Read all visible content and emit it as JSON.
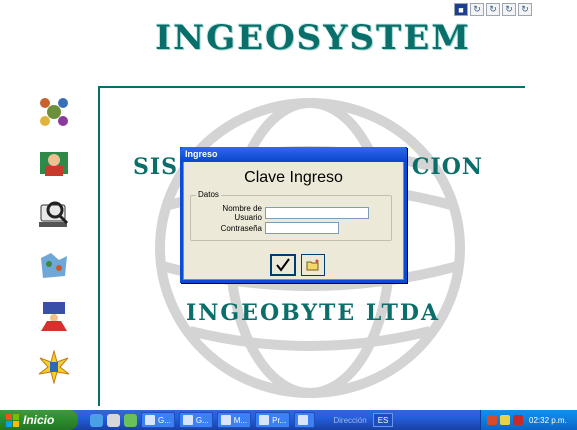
{
  "app": {
    "title": "INGEOSYSTEM",
    "subtitle_left": "SIS",
    "subtitle_right": "CION",
    "company": "INGEOBYTE LTDA"
  },
  "side_icons": [
    {
      "name": "team-icon"
    },
    {
      "name": "reading-person-icon"
    },
    {
      "name": "magnifier-computer-icon"
    },
    {
      "name": "map-icon"
    },
    {
      "name": "presenter-icon"
    },
    {
      "name": "starburst-icon"
    }
  ],
  "dialog": {
    "title": "Ingreso",
    "heading": "Clave Ingreso",
    "group_label": "Datos",
    "username_label": "Nombre de Usuario",
    "username_value": "",
    "password_label": "Contraseña",
    "password_value": ""
  },
  "taskbar": {
    "start_label": "Inicio",
    "tasks": [
      {
        "label": "G..."
      },
      {
        "label": "G..."
      },
      {
        "label": "M..."
      },
      {
        "label": "Pr..."
      },
      {
        "label": ""
      }
    ],
    "address_label": "Dirección",
    "language": "ES",
    "clock": "02:32 p.m."
  },
  "colors": {
    "teal": "#0a6e6a",
    "taskbar_blue": "#245edb",
    "start_green": "#2d8a2d",
    "dialog_border": "#0a4bd8"
  }
}
